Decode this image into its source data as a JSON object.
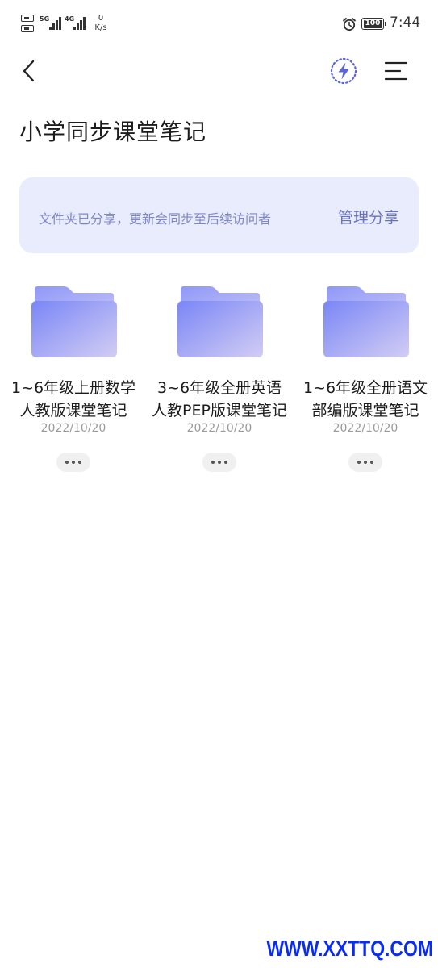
{
  "status_bar": {
    "sim1_network": "5G",
    "sim2_network": "4G",
    "net_speed_value": "0",
    "net_speed_unit": "K/s",
    "battery_level": "100",
    "time": "7:44",
    "icons": [
      "sim-icon",
      "signal-icon",
      "alarm-icon",
      "battery-icon"
    ]
  },
  "toolbar": {
    "back_icon": "chevron-left-icon",
    "flash_icon": "lightning-bolt-icon",
    "menu_icon": "menu-lines-icon"
  },
  "page": {
    "title": "小学同步课堂笔记"
  },
  "share_banner": {
    "message": "文件夹已分享，更新会同步至后续访问者",
    "action_label": "管理分享"
  },
  "folders": [
    {
      "name": "1~6年级上册数学人教版课堂笔记",
      "date": "2022/10/20",
      "icon": "folder-icon"
    },
    {
      "name": "3~6年级全册英语人教PEP版课堂笔记",
      "date": "2022/10/20",
      "icon": "folder-icon"
    },
    {
      "name": "1~6年级全册语文部编版课堂笔记",
      "date": "2022/10/20",
      "icon": "folder-icon"
    }
  ],
  "watermark": "WWW.XXTTQ.COM",
  "colors": {
    "banner_background": "#e9ecfd",
    "banner_text": "#7e87c9",
    "accent": "#6772c4",
    "folder_gradient_start": "#7f8bf7",
    "folder_gradient_end": "#cfcaf3",
    "watermark": "#0a2cf0"
  }
}
